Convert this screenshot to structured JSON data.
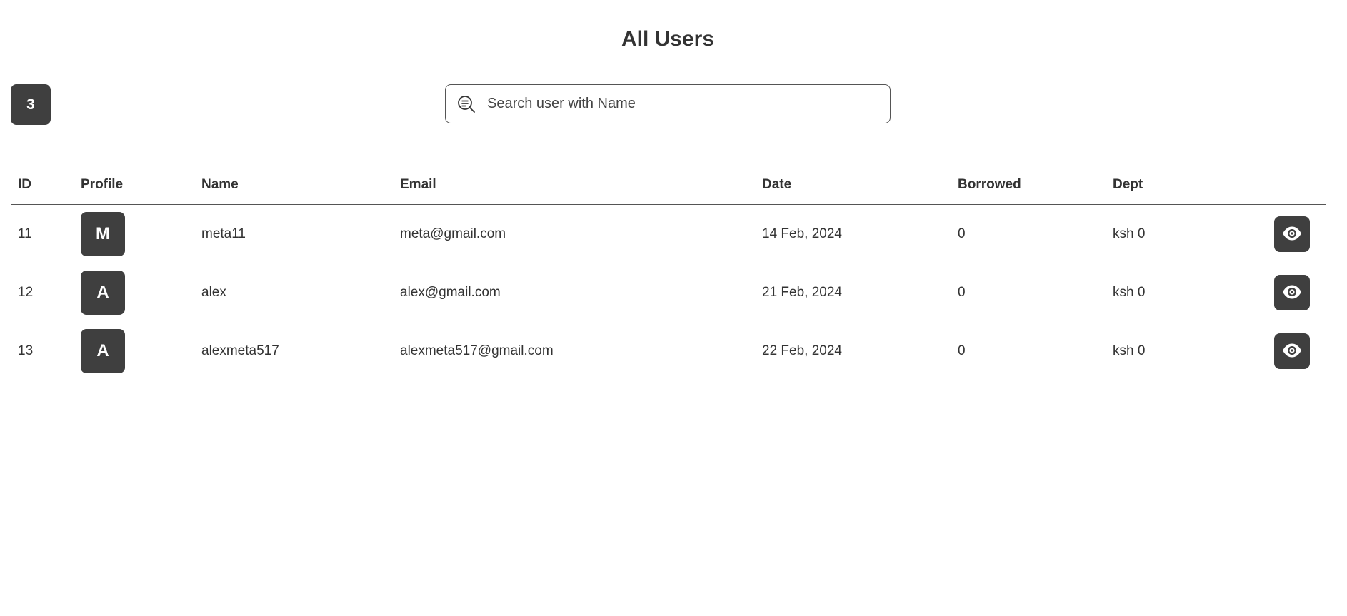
{
  "header": {
    "title": "All Users"
  },
  "user_count": "3",
  "search": {
    "placeholder": "Search user with Name",
    "value": ""
  },
  "table": {
    "columns": {
      "id": "ID",
      "profile": "Profile",
      "name": "Name",
      "email": "Email",
      "date": "Date",
      "borrowed": "Borrowed",
      "dept": "Dept"
    },
    "rows": [
      {
        "id": "11",
        "initial": "M",
        "name": "meta11",
        "email": "meta@gmail.com",
        "date": "14 Feb, 2024",
        "borrowed": "0",
        "dept": "ksh 0",
        "action_icon": "eye-icon"
      },
      {
        "id": "12",
        "initial": "A",
        "name": "alex",
        "email": "alex@gmail.com",
        "date": "21 Feb, 2024",
        "borrowed": "0",
        "dept": "ksh 0",
        "action_icon": "eye-icon"
      },
      {
        "id": "13",
        "initial": "A",
        "name": "alexmeta517",
        "email": "alexmeta517@gmail.com",
        "date": "22 Feb, 2024",
        "borrowed": "0",
        "dept": "ksh 0",
        "action_icon": "eye-icon"
      }
    ]
  },
  "colors": {
    "accent_dark": "#3f3f3f",
    "text": "#333333",
    "background": "#ffffff"
  },
  "icons": {
    "search": "search-icon",
    "view": "eye-icon"
  }
}
